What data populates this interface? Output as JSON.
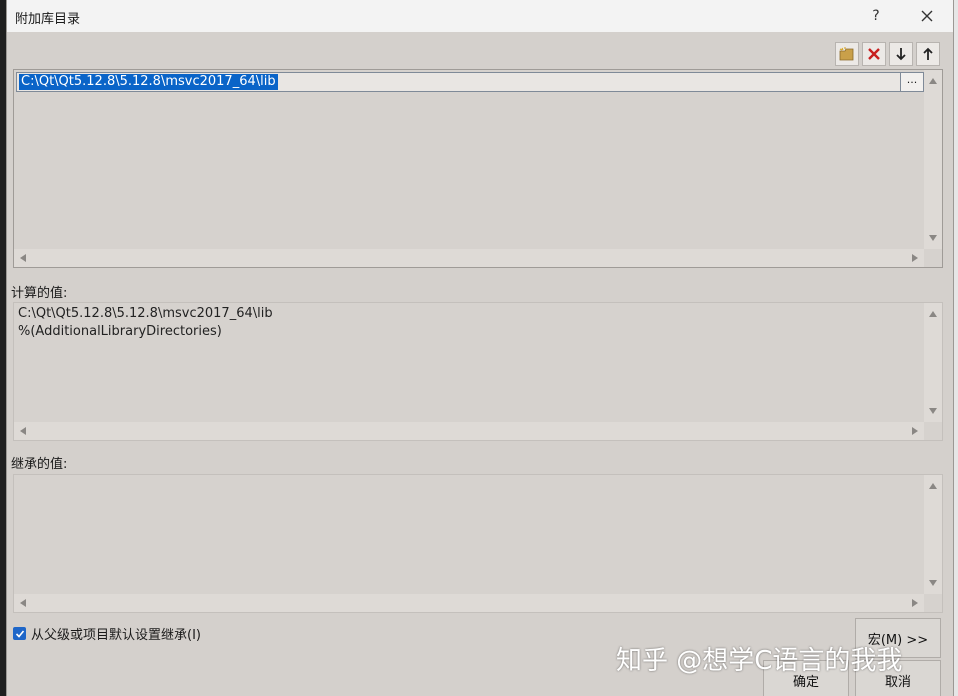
{
  "window": {
    "title": "附加库目录",
    "help_label": "?"
  },
  "toolbar": {
    "items": [
      "new-folder",
      "delete",
      "move-down",
      "move-up"
    ]
  },
  "editor": {
    "entry": "C:\\Qt\\Qt5.12.8\\5.12.8\\msvc2017_64\\lib",
    "browse_label": "..."
  },
  "evaluated": {
    "label": "计算的值:",
    "lines": [
      "C:\\Qt\\Qt5.12.8\\5.12.8\\msvc2017_64\\lib",
      "%(AdditionalLibraryDirectories)"
    ]
  },
  "inherited": {
    "label": "继承的值:"
  },
  "inherit_checkbox": {
    "label": "从父级或项目默认设置继承(I)",
    "checked": true
  },
  "buttons": {
    "macros": "宏(M) >>",
    "ok": "确定",
    "cancel": "取消"
  },
  "watermark": "知乎 @想学C语言的我我",
  "colors": {
    "selection": "#0a64c8",
    "checkbox": "#1e66c8",
    "dialog_bg": "#d4d0cc"
  }
}
